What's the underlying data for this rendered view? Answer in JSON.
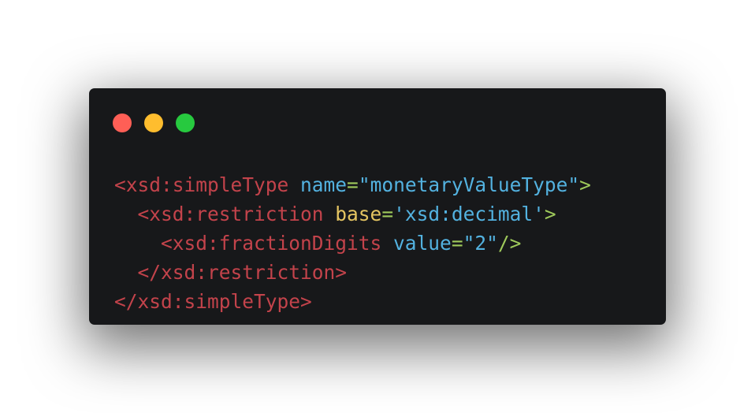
{
  "window": {
    "controls": [
      {
        "name": "close",
        "color": "#ff5f56"
      },
      {
        "name": "minimize",
        "color": "#ffbd2e"
      },
      {
        "name": "maximize",
        "color": "#27c93f"
      }
    ]
  },
  "code": {
    "line1": {
      "indent": "",
      "open": "<xsd:simpleType",
      "sp": " ",
      "attr": "name",
      "eq": "=",
      "value": "\"monetaryValueType\"",
      "end": ">"
    },
    "line2": {
      "indent": "  ",
      "open": "<xsd:restriction",
      "sp": " ",
      "attr": "base",
      "eq": "=",
      "value": "'xsd:decimal'",
      "end": ">"
    },
    "line3": {
      "indent": "    ",
      "open": "<xsd:fractionDigits",
      "sp": " ",
      "attr": "value",
      "eq": "=",
      "value": "\"2\"",
      "end": "/>"
    },
    "line4": {
      "indent": "  ",
      "text": "</xsd:restriction>"
    },
    "line5": {
      "indent": "",
      "text": "</xsd:simpleType>"
    }
  }
}
